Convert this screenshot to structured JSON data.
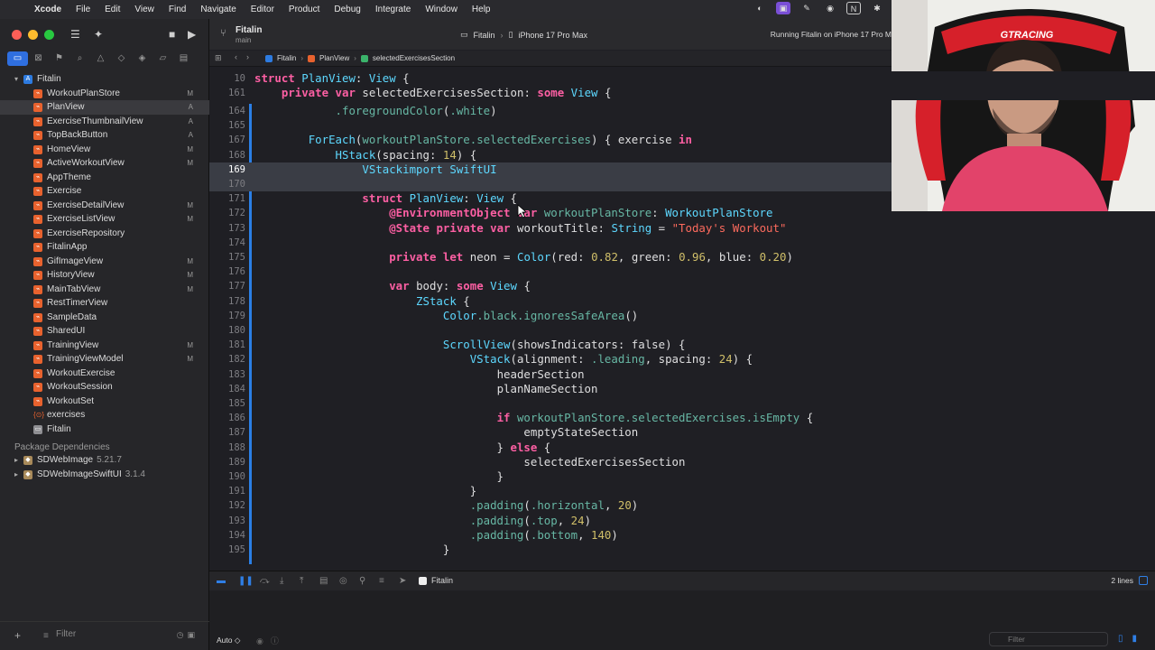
{
  "menubar": {
    "app_name": "Xcode",
    "items": [
      "File",
      "Edit",
      "View",
      "Find",
      "Navigate",
      "Editor",
      "Product",
      "Debug",
      "Integrate",
      "Window",
      "Help"
    ]
  },
  "toolbar": {
    "project": "Fitalin",
    "branch": "main",
    "scheme": "Fitalin",
    "destination": "iPhone 17 Pro Max",
    "run_status": "Running Fitalin on iPhone 17 Pro M"
  },
  "jumpbar": {
    "crumbs": [
      "Fitalin",
      "PlanView",
      "selectedExercisesSection"
    ]
  },
  "navigator": {
    "project_root": "Fitalin",
    "files": [
      {
        "name": "WorkoutPlanStore",
        "status": "M",
        "kind": "swift"
      },
      {
        "name": "PlanView",
        "status": "A",
        "kind": "swift"
      },
      {
        "name": "ExerciseThumbnailView",
        "status": "A",
        "kind": "swift"
      },
      {
        "name": "TopBackButton",
        "status": "A",
        "kind": "swift"
      },
      {
        "name": "HomeView",
        "status": "M",
        "kind": "swift"
      },
      {
        "name": "ActiveWorkoutView",
        "status": "M",
        "kind": "swift"
      },
      {
        "name": "AppTheme",
        "status": "",
        "kind": "swift"
      },
      {
        "name": "Exercise",
        "status": "",
        "kind": "swift"
      },
      {
        "name": "ExerciseDetailView",
        "status": "M",
        "kind": "swift"
      },
      {
        "name": "ExerciseListView",
        "status": "M",
        "kind": "swift"
      },
      {
        "name": "ExerciseRepository",
        "status": "",
        "kind": "swift"
      },
      {
        "name": "FitalinApp",
        "status": "",
        "kind": "swift"
      },
      {
        "name": "GifImageView",
        "status": "M",
        "kind": "swift"
      },
      {
        "name": "HistoryView",
        "status": "M",
        "kind": "swift"
      },
      {
        "name": "MainTabView",
        "status": "M",
        "kind": "swift"
      },
      {
        "name": "RestTimerView",
        "status": "",
        "kind": "swift"
      },
      {
        "name": "SampleData",
        "status": "",
        "kind": "swift"
      },
      {
        "name": "SharedUI",
        "status": "",
        "kind": "swift"
      },
      {
        "name": "TrainingView",
        "status": "M",
        "kind": "swift"
      },
      {
        "name": "TrainingViewModel",
        "status": "M",
        "kind": "swift"
      },
      {
        "name": "WorkoutExercise",
        "status": "",
        "kind": "swift"
      },
      {
        "name": "WorkoutSession",
        "status": "",
        "kind": "swift"
      },
      {
        "name": "WorkoutSet",
        "status": "",
        "kind": "swift"
      },
      {
        "name": "exercises",
        "status": "",
        "kind": "assets"
      },
      {
        "name": "Fitalin",
        "status": "",
        "kind": "folder"
      }
    ],
    "package_section": "Package Dependencies",
    "packages": [
      {
        "name": "SDWebImage",
        "version": "5.21.7"
      },
      {
        "name": "SDWebImageSwiftUI",
        "version": "3.1.4"
      }
    ],
    "filter_placeholder": "Filter"
  },
  "editor": {
    "sticky_lines": [
      {
        "ln": "10",
        "code": "struct PlanView: View {"
      },
      {
        "ln": "161",
        "code": "    private var selectedExercisesSection: some View {"
      }
    ],
    "lines": [
      {
        "ln": "164",
        "code": "            .foregroundColor(.white)"
      },
      {
        "ln": "165",
        "code": ""
      },
      {
        "ln": "167",
        "code": "        ForEach(workoutPlanStore.selectedExercises) { exercise in"
      },
      {
        "ln": "168",
        "code": "            HStack(spacing: 14) {"
      },
      {
        "ln": "169",
        "code": "                VStackimport SwiftUI"
      },
      {
        "ln": "170",
        "code": ""
      },
      {
        "ln": "171",
        "code": "                struct PlanView: View {"
      },
      {
        "ln": "172",
        "code": "                    @EnvironmentObject var workoutPlanStore: WorkoutPlanStore"
      },
      {
        "ln": "173",
        "code": "                    @State private var workoutTitle: String = \"Today's Workout\""
      },
      {
        "ln": "174",
        "code": ""
      },
      {
        "ln": "175",
        "code": "                    private let neon = Color(red: 0.82, green: 0.96, blue: 0.20)"
      },
      {
        "ln": "176",
        "code": ""
      },
      {
        "ln": "177",
        "code": "                    var body: some View {"
      },
      {
        "ln": "178",
        "code": "                        ZStack {"
      },
      {
        "ln": "179",
        "code": "                            Color.black.ignoresSafeArea()"
      },
      {
        "ln": "180",
        "code": ""
      },
      {
        "ln": "181",
        "code": "                            ScrollView(showsIndicators: false) {"
      },
      {
        "ln": "182",
        "code": "                                VStack(alignment: .leading, spacing: 24) {"
      },
      {
        "ln": "183",
        "code": "                                    headerSection"
      },
      {
        "ln": "184",
        "code": "                                    planNameSection"
      },
      {
        "ln": "185",
        "code": ""
      },
      {
        "ln": "186",
        "code": "                                    if workoutPlanStore.selectedExercises.isEmpty {"
      },
      {
        "ln": "187",
        "code": "                                        emptyStateSection"
      },
      {
        "ln": "188",
        "code": "                                    } else {"
      },
      {
        "ln": "189",
        "code": "                                        selectedExercisesSection"
      },
      {
        "ln": "190",
        "code": "                                    }"
      },
      {
        "ln": "191",
        "code": "                                }"
      },
      {
        "ln": "192",
        "code": "                                .padding(.horizontal, 20)"
      },
      {
        "ln": "193",
        "code": "                                .padding(.top, 24)"
      },
      {
        "ln": "194",
        "code": "                                .padding(.bottom, 140)"
      },
      {
        "ln": "195",
        "code": "                            }"
      }
    ]
  },
  "debugbar": {
    "target": "Fitalin",
    "line_count": "2 lines"
  },
  "console": {
    "mode": "Auto ◇",
    "filter_placeholder": "Filter"
  },
  "webcam": {
    "chair_brand": "GTRACING"
  },
  "colors": {
    "accent": "#2f7fe6",
    "keyword": "#fc5fa3",
    "type": "#5dd8ff",
    "property": "#67b7a4",
    "string": "#fc6a5d",
    "number": "#d0bf69"
  }
}
